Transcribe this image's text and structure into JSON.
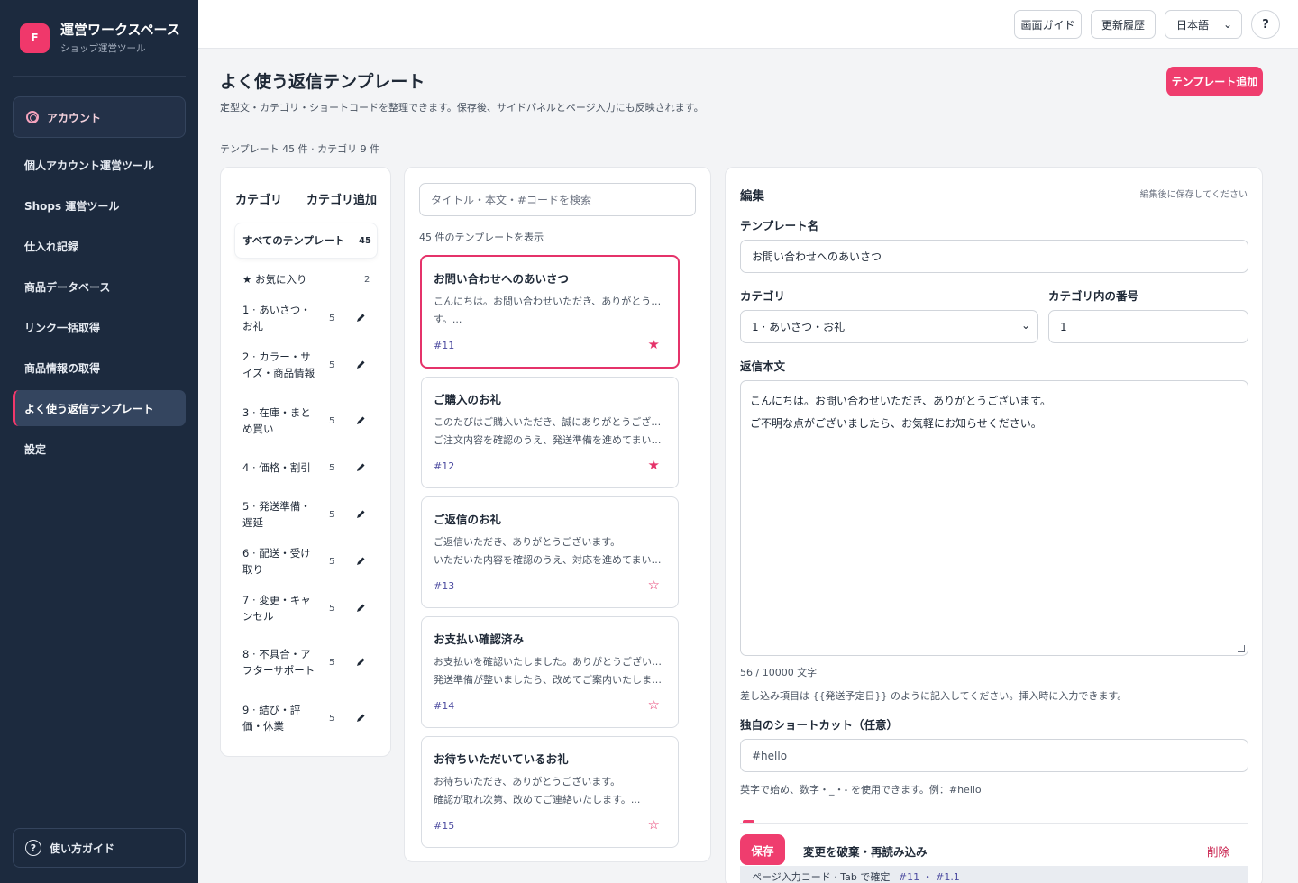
{
  "sidebar": {
    "logo_letter": "F",
    "brand_name": "運営ワークスペース",
    "brand_sub": "ショップ運営ツール",
    "account_label": "アカウント",
    "items": [
      {
        "label": "個人アカウント運営ツール",
        "active": false
      },
      {
        "label": "Shops 運営ツール",
        "active": false
      },
      {
        "label": "仕入れ記録",
        "active": false
      },
      {
        "label": "商品データベース",
        "active": false
      },
      {
        "label": "リンク一括取得",
        "active": false
      },
      {
        "label": "商品情報の取得",
        "active": false
      },
      {
        "label": "よく使う返信テンプレート",
        "active": true
      },
      {
        "label": "設定",
        "active": false
      }
    ],
    "guide_label": "使い方ガイド"
  },
  "topbar": {
    "screen_guide": "画面ガイド",
    "history": "更新履歴",
    "language": "日本語",
    "help": "?"
  },
  "page": {
    "title": "よく使う返信テンプレート",
    "description": "定型文・カテゴリ・ショートコードを整理できます。保存後、サイドパネルとページ入力にも反映されます。",
    "add_button": "テンプレート追加",
    "counts": "テンプレート 45 件 · カテゴリ 9 件"
  },
  "categories": {
    "heading": "カテゴリ",
    "add_label": "カテゴリ追加",
    "all": {
      "label": "すべてのテンプレート",
      "count": "45"
    },
    "favorites": {
      "label": "★ お気に入り",
      "count": "2"
    },
    "items": [
      {
        "label": "1 · あいさつ・お礼",
        "count": "5"
      },
      {
        "label": "2 · カラー・サイズ・商品情報",
        "count": "5"
      },
      {
        "label": "3 · 在庫・まとめ買い",
        "count": "5"
      },
      {
        "label": "4 · 価格・割引",
        "count": "5"
      },
      {
        "label": "5 · 発送準備・遅延",
        "count": "5"
      },
      {
        "label": "6 · 配送・受け取り",
        "count": "5"
      },
      {
        "label": "7 · 変更・キャンセル",
        "count": "5"
      },
      {
        "label": "8 · 不具合・アフターサポート",
        "count": "5"
      },
      {
        "label": "9 · 結び・評価・休業",
        "count": "5"
      }
    ]
  },
  "templates": {
    "search_placeholder": "タイトル・本文・#コードを検索",
    "count_text": "45 件のテンプレートを表示",
    "cards": [
      {
        "title": "お問い合わせへのあいさつ",
        "line1": "こんにちは。お問い合わせいただき、ありがとうございま",
        "line2": "す。...",
        "code": "#11",
        "star": "★",
        "favorite": true,
        "selected": true
      },
      {
        "title": "ご購入のお礼",
        "line1": "このたびはご購入いただき、誠にありがとうございます。",
        "line2": "ご注文内容を確認のうえ、発送準備を進めてまいります。...",
        "code": "#12",
        "star": "★",
        "favorite": true,
        "selected": false
      },
      {
        "title": "ご返信のお礼",
        "line1": "ご返信いただき、ありがとうございます。",
        "line2": "いただいた内容を確認のうえ、対応を進めてまいります。...",
        "code": "#13",
        "star": "☆",
        "favorite": false,
        "selected": false
      },
      {
        "title": "お支払い確認済み",
        "line1": "お支払いを確認いたしました。ありがとうございます。",
        "line2": "発送準備が整いましたら、改めてご案内いたします。...",
        "code": "#14",
        "star": "☆",
        "favorite": false,
        "selected": false
      },
      {
        "title": "お待ちいただいているお礼",
        "line1": "お待ちいただき、ありがとうございます。",
        "line2": "確認が取れ次第、改めてご連絡いたします。...",
        "code": "#15",
        "star": "☆",
        "favorite": false,
        "selected": false
      }
    ]
  },
  "editor": {
    "heading": "編集",
    "hint": "編集後に保存してください",
    "name_label": "テンプレート名",
    "name_value": "お問い合わせへのあいさつ",
    "category_label": "カテゴリ",
    "category_value": "1 · あいさつ・お礼",
    "number_label": "カテゴリ内の番号",
    "number_value": "1",
    "body_label": "返信本文",
    "body_line1": "こんにちは。お問い合わせいただき、ありがとうございます。",
    "body_line2": "ご不明な点がございましたら、お気軽にお知らせください。",
    "char_count": "56 / 10000 文字",
    "placeholder_hint": "差し込み項目は {{発送予定日}} のように記入してください。挿入時に入力できます。",
    "shortcut_label": "独自のショートカット（任意）",
    "shortcut_placeholder": "#hello",
    "shortcut_hint": "英字で始め、数字・_・- を使用できます。例：#hello",
    "save": "保存",
    "discard": "変更を破棄・再読み込み",
    "delete": "削除",
    "code_bar_label": "ページ入力コード · Tab で確定",
    "code_bar_codes": "#11 ・ #1.1"
  },
  "colors": {
    "sidebar_bg": "#1c2a3e",
    "accent": "#ef3d6e",
    "code_color": "#4c4ba0"
  }
}
